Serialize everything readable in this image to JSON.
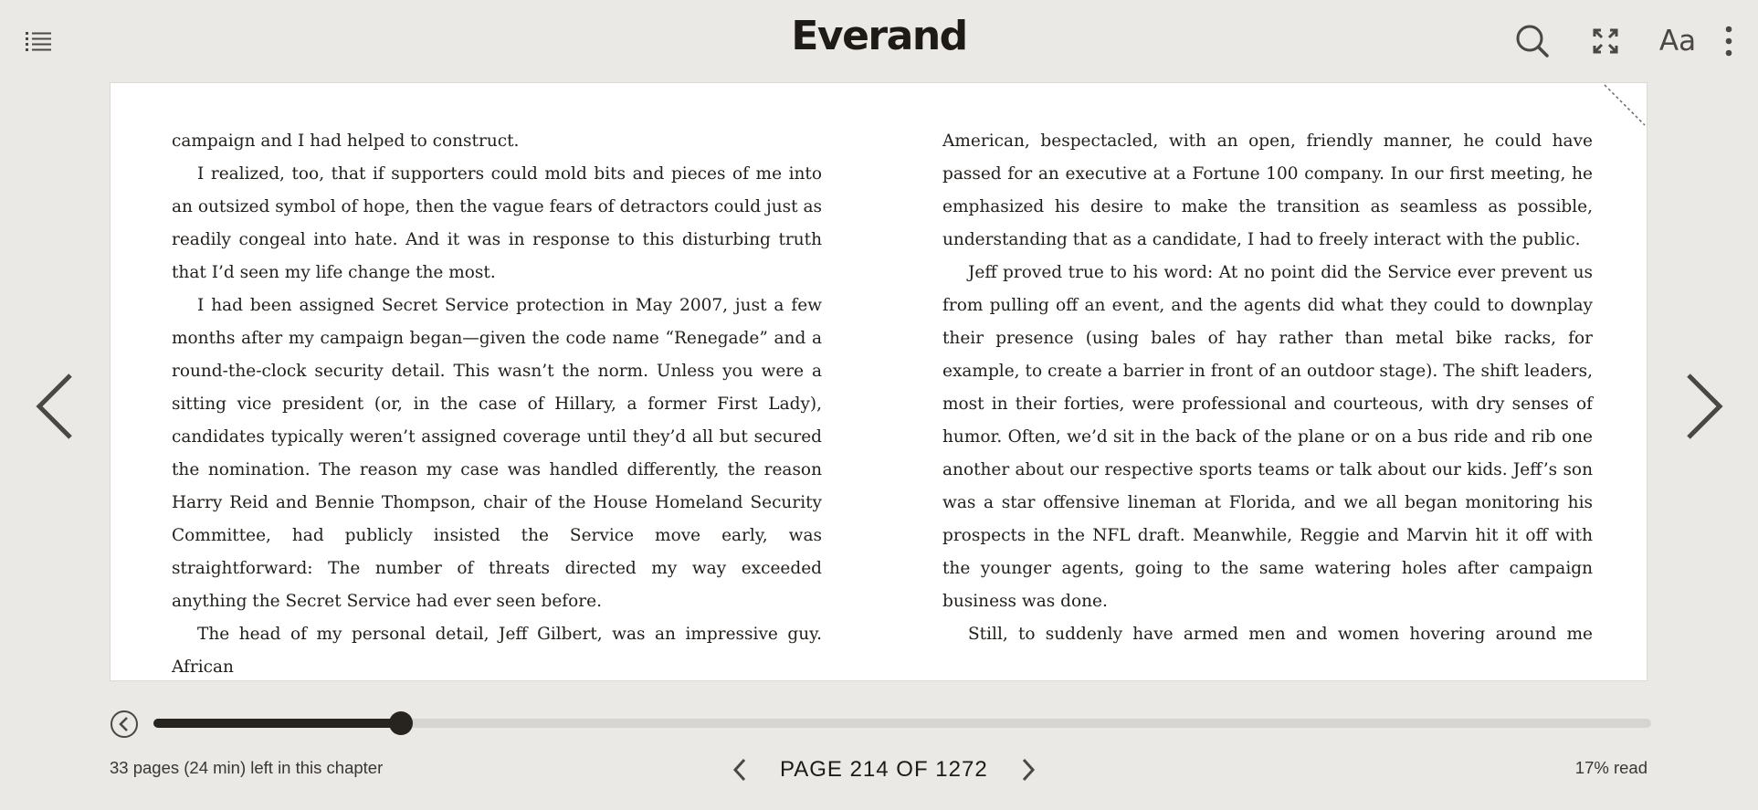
{
  "app": {
    "brand": "Everand"
  },
  "toolbar": {
    "toc_icon": "list-icon",
    "search_icon": "search-icon",
    "fullscreen_icon": "expand-icon",
    "font_settings_label": "Aa",
    "more_icon": "more-vertical-icon"
  },
  "reader": {
    "left_column": [
      "campaign and I had helped to construct.",
      "I realized, too, that if supporters could mold bits and pieces of me into an outsized symbol of hope, then the vague fears of detractors could just as readily congeal into hate. And it was in response to this disturbing truth that I’d seen my life change the most.",
      "I had been assigned Secret Service protection in May 2007, just a few months after my campaign began—given the code name “Renegade” and a round-the-clock security detail. This wasn’t the norm. Unless you were a sitting vice president (or, in the case of Hillary, a former First Lady), candidates typically weren’t assigned coverage until they’d all but secured the nomination. The reason my case was handled differently, the reason Harry Reid and Bennie Thompson, chair of the House Homeland Security Committee, had publicly insisted the Service move early, was straightforward: The number of threats directed my way exceeded anything the Secret Service had ever seen before.",
      "The head of my personal detail, Jeff Gilbert, was an impressive guy. African"
    ],
    "right_column": [
      "American, bespectacled, with an open, friendly manner, he could have passed for an executive at a Fortune 100 company. In our first meeting, he emphasized his desire to make the transition as seamless as possible, understanding that as a candidate, I had to freely interact with the public.",
      "Jeff proved true to his word: At no point did the Service ever prevent us from pulling off an event, and the agents did what they could to downplay their presence (using bales of hay rather than metal bike racks, for example, to create a barrier in front of an outdoor stage). The shift leaders, most in their forties, were professional and courteous, with dry senses of humor. Often, we’d sit in the back of the plane or on a bus ride and rib one another about our respective sports teams or talk about our kids. Jeff’s son was a star offensive lineman at Florida, and we all began monitoring his prospects in the NFL draft. Meanwhile, Reggie and Marvin hit it off with the younger agents, going to the same watering holes after campaign business was done.",
      "Still, to suddenly have armed men and women hovering around me"
    ],
    "prev_icon": "chevron-left-icon",
    "next_icon": "chevron-right-icon"
  },
  "footer": {
    "back_icon": "circle-chevron-left-icon",
    "progress_fraction": 0.165,
    "chapter_remaining": "33 pages (24 min) left in this chapter",
    "page_label": "PAGE 214 OF 1272",
    "percent_read": "17% read"
  },
  "colors": {
    "background": "#ebe9e6",
    "page": "#ffffff",
    "ink": "#1e1a16",
    "progress_fill": "#27231f",
    "progress_track": "#d7d5d2"
  }
}
